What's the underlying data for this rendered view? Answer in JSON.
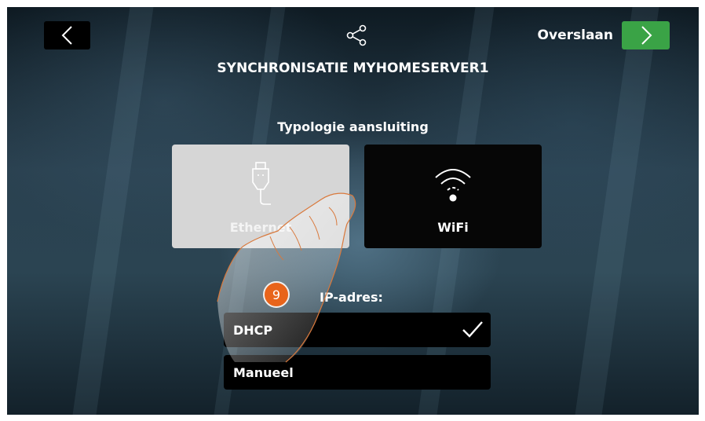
{
  "header": {
    "title": "SYNCHRONISATIE MYHOMESERVER1",
    "skip_label": "Overslaan",
    "back_icon": "chevron-left-icon",
    "next_icon": "chevron-right-icon",
    "share_icon": "share-icon"
  },
  "connection": {
    "heading": "Typologie aansluiting",
    "options": [
      {
        "label": "Ethernet",
        "icon": "ethernet-plug-icon",
        "selected": true
      },
      {
        "label": "WiFi",
        "icon": "wifi-icon",
        "selected": false
      }
    ]
  },
  "ip": {
    "heading": "IP-adres:",
    "options": [
      {
        "label": "DHCP",
        "checked": true
      },
      {
        "label": "Manueel",
        "checked": false
      }
    ]
  },
  "callout": {
    "step_number": "9"
  },
  "colors": {
    "accent_green": "#3aa346",
    "callout_orange": "#e8641b",
    "selected_card": "#d6d6d6"
  }
}
